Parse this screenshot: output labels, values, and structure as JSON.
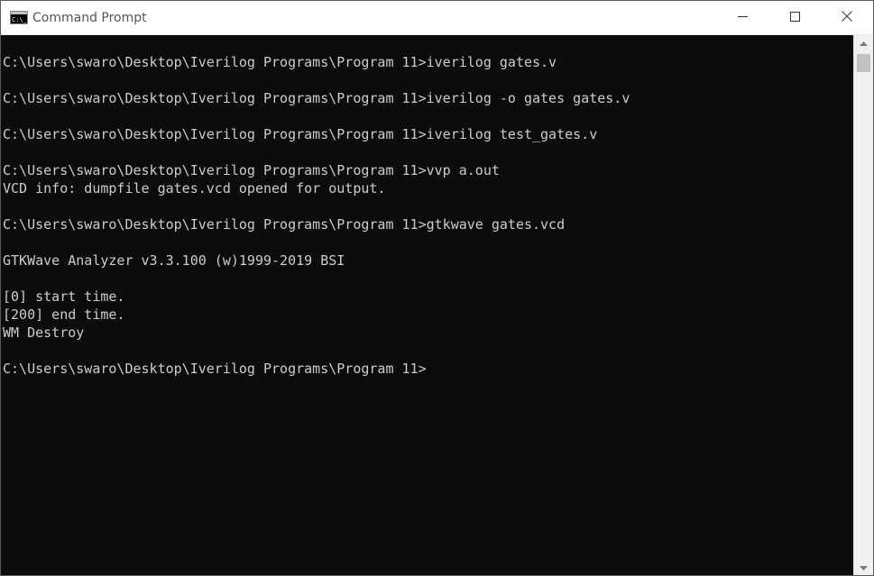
{
  "window": {
    "title": "Command Prompt",
    "app_icon": "cmd-icon"
  },
  "controls": {
    "minimize_icon": "minimize-icon",
    "maximize_icon": "maximize-icon",
    "close_icon": "close-icon"
  },
  "console": {
    "text_color": "#cccccc",
    "background": "#0c0c0c",
    "lines": [
      "C:\\Users\\swaro\\Desktop\\Iverilog Programs\\Program 11>iverilog gates.v",
      "C:\\Users\\swaro\\Desktop\\Iverilog Programs\\Program 11>iverilog -o gates gates.v",
      "C:\\Users\\swaro\\Desktop\\Iverilog Programs\\Program 11>iverilog test_gates.v",
      "C:\\Users\\swaro\\Desktop\\Iverilog Programs\\Program 11>vvp a.out",
      "VCD info: dumpfile gates.vcd opened for output.",
      "C:\\Users\\swaro\\Desktop\\Iverilog Programs\\Program 11>gtkwave gates.vcd",
      "GTKWave Analyzer v3.3.100 (w)1999-2019 BSI",
      "[0] start time.",
      "[200] end time.",
      "WM Destroy",
      "C:\\Users\\swaro\\Desktop\\Iverilog Programs\\Program 11>"
    ]
  },
  "scrollbar": {
    "up_icon": "scroll-up-arrow-icon",
    "down_icon": "scroll-down-arrow-icon"
  }
}
